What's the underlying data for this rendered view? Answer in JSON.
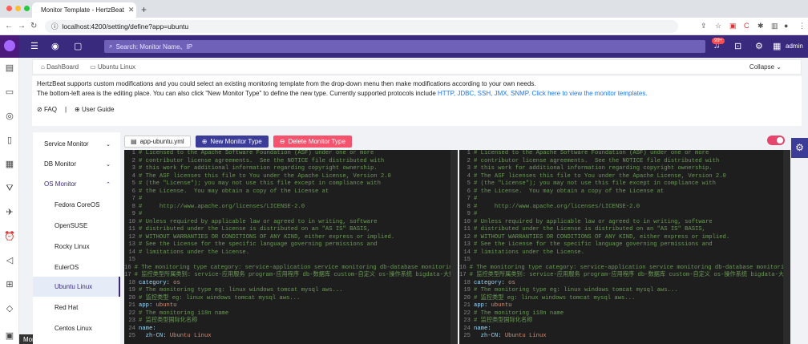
{
  "browser": {
    "tab_title": "Monitor Template - HertzBeat",
    "url": "localhost:4200/setting/define?app=ubuntu"
  },
  "topbar": {
    "search_placeholder": "Search: Monitor Name、IP",
    "badge": "99+",
    "user": "admin"
  },
  "tabs": {
    "dashboard": "DashBoard",
    "ubuntu": "Ubuntu Linux",
    "collapse": "Collapse"
  },
  "info": {
    "line1": "HertzBeat supports custom modifications and you could select an existing monitoring template from the drop-down menu then make modifications according to your own needs.",
    "line2_a": "The bottom-left area is the editing place. You can also click \"New Monitor Type\" to define the new type. Currently supported protocols include ",
    "protocols": "HTTP, JDBC, SSH, JMX, SNMP.",
    "link": "Click here to view the monitor templates.",
    "faq": "FAQ",
    "guide": "User Guide"
  },
  "menu": {
    "items": [
      {
        "label": "Service Monitor",
        "arrow": "⌄"
      },
      {
        "label": "DB Monitor",
        "arrow": "⌄"
      },
      {
        "label": "OS Monitor",
        "arrow": "⌃"
      },
      {
        "label": "Fedora CoreOS",
        "arrow": ""
      },
      {
        "label": "OpenSUSE",
        "arrow": ""
      },
      {
        "label": "Rocky Linux",
        "arrow": ""
      },
      {
        "label": "EulerOS",
        "arrow": ""
      },
      {
        "label": "Ubuntu Linux",
        "arrow": ""
      },
      {
        "label": "Red Hat",
        "arrow": ""
      },
      {
        "label": "Centos Linux",
        "arrow": ""
      }
    ]
  },
  "toolbar": {
    "file": "app-ubuntu.yml",
    "new": "New Monitor Type",
    "delete": "Delete Monitor Type"
  },
  "tooltip": "Monitor Template",
  "code_lines": [
    {
      "n": "1",
      "t": "# Licensed to the Apache Software Foundation (ASF) under one or more",
      "k": "c"
    },
    {
      "n": "2",
      "t": "# contributor license agreements.  See the NOTICE file distributed with",
      "k": "c"
    },
    {
      "n": "3",
      "t": "# this work for additional information regarding copyright ownership.",
      "k": "c"
    },
    {
      "n": "4",
      "t": "# The ASF licenses this file to You under the Apache License, Version 2.0",
      "k": "c"
    },
    {
      "n": "5",
      "t": "# (the \"License\"); you may not use this file except in compliance with",
      "k": "c"
    },
    {
      "n": "6",
      "t": "# the License.  You may obtain a copy of the License at",
      "k": "c"
    },
    {
      "n": "7",
      "t": "#",
      "k": "c"
    },
    {
      "n": "8",
      "t": "#     http://www.apache.org/licenses/LICENSE-2.0",
      "k": "c"
    },
    {
      "n": "9",
      "t": "#",
      "k": "c"
    },
    {
      "n": "10",
      "t": "# Unless required by applicable law or agreed to in writing, software",
      "k": "c"
    },
    {
      "n": "11",
      "t": "# distributed under the License is distributed on an \"AS IS\" BASIS,",
      "k": "c"
    },
    {
      "n": "12",
      "t": "# WITHOUT WARRANTIES OR CONDITIONS OF ANY KIND, either express or implied.",
      "k": "c"
    },
    {
      "n": "13",
      "t": "# See the License for the specific language governing permissions and",
      "k": "c"
    },
    {
      "n": "14",
      "t": "# limitations under the License.",
      "k": "c"
    },
    {
      "n": "15",
      "t": "",
      "k": "c"
    },
    {
      "n": "16",
      "t": "# The monitoring type category: service-application service monitoring db-database monitoring custom-c",
      "k": "c"
    },
    {
      "n": "17",
      "t": "# 监控类型所属类别: service-应用服务 program-应用程序 db-数据库 custom-自定义 os-操作系统 bigdata-大数据 mid-中件",
      "k": "c"
    },
    {
      "n": "18",
      "t": "category: os",
      "k": "k"
    },
    {
      "n": "19",
      "t": "# The monitoring type eg: linux windows tomcat mysql aws...",
      "k": "c"
    },
    {
      "n": "20",
      "t": "# 监控类型 eg: linux windows tomcat mysql aws...",
      "k": "c"
    },
    {
      "n": "21",
      "t": "app: ubuntu",
      "k": "k"
    },
    {
      "n": "22",
      "t": "# The monitoring i18n name",
      "k": "c"
    },
    {
      "n": "23",
      "t": "# 监控类型国际化名称",
      "k": "c"
    },
    {
      "n": "24",
      "t": "name:",
      "k": "k"
    },
    {
      "n": "25",
      "t": "  zh-CN: Ubuntu Linux",
      "k": "k"
    }
  ]
}
